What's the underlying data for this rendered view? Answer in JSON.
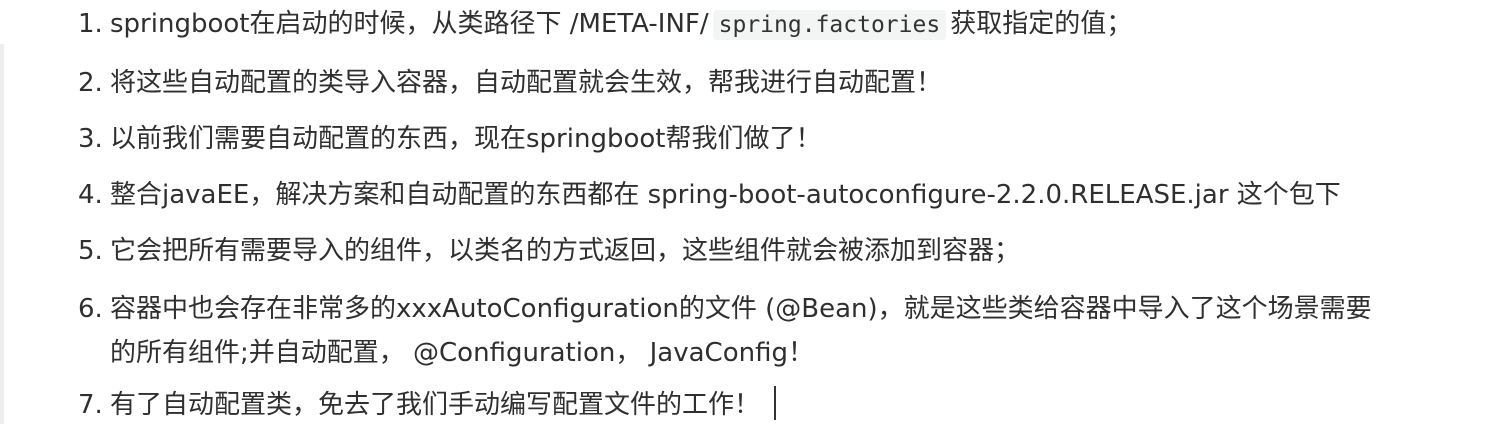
{
  "items": [
    {
      "number": "1.",
      "text_before": "springboot在启动的时候，从类路径下 /META-INF/",
      "code": "spring.factories",
      "text_after": "获取指定的值；"
    },
    {
      "number": "2.",
      "text": "将这些自动配置的类导入容器，自动配置就会生效，帮我进行自动配置！"
    },
    {
      "number": "3.",
      "text": "以前我们需要自动配置的东西，现在springboot帮我们做了！"
    },
    {
      "number": "4.",
      "text": "整合javaEE，解决方案和自动配置的东西都在 spring-boot-autoconfigure-2.2.0.RELEASE.jar 这个包下"
    },
    {
      "number": "5.",
      "text": "它会把所有需要导入的组件，以类名的方式返回，这些组件就会被添加到容器；"
    },
    {
      "number": "6.",
      "line1": "容器中也会存在非常多的xxxAutoConfiguration的文件 (@Bean)，就是这些类给容器中导入了这个场景需要",
      "line2": "的所有组件;并自动配置， @Configuration， JavaConfig！"
    },
    {
      "number": "7.",
      "text": "有了自动配置类，免去了我们手动编写配置文件的工作！"
    }
  ]
}
